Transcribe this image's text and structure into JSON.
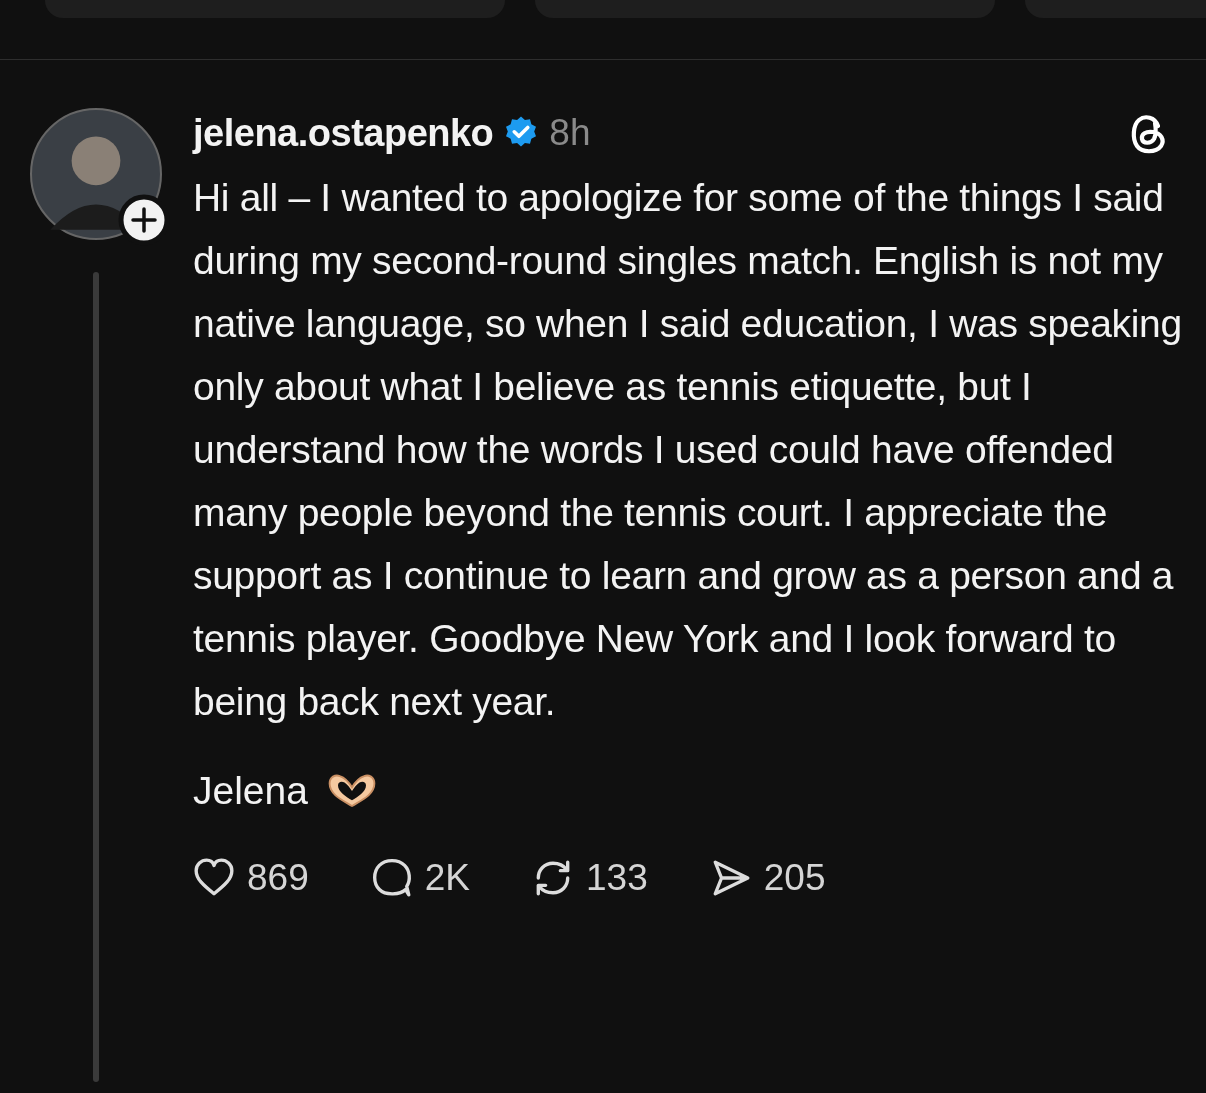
{
  "post": {
    "username": "jelena.ostapenko",
    "verified": true,
    "time": "8h",
    "text": "Hi all – I wanted to apologize for some of the things I said during my second-round singles match. English is not my native language, so when I said education, I was speaking only about what I believe as tennis etiquette, but I understand how the words I used could have offended many people beyond the tennis court. I appreciate the support as I continue to learn and grow as a person and a tennis player. Goodbye New York and I look forward to being back next year.",
    "signoff": "Jelena",
    "actions": [
      {
        "kind": "like",
        "count": "869"
      },
      {
        "kind": "reply",
        "count": "2K"
      },
      {
        "kind": "repost",
        "count": "133"
      },
      {
        "kind": "share",
        "count": "205"
      }
    ]
  }
}
